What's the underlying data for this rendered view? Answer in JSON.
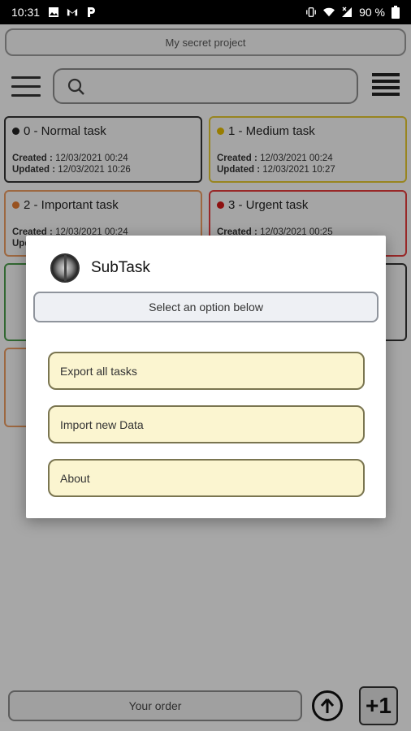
{
  "status_bar": {
    "time": "10:31",
    "battery": "90 %",
    "left_icons": [
      "image-icon",
      "gmail-icon",
      "p-app-icon"
    ],
    "right_icons": [
      "vibrate-icon",
      "wifi-icon",
      "signal-icon",
      "battery-icon"
    ]
  },
  "header": {
    "project_title": "My secret project",
    "search_placeholder": ""
  },
  "tasks": [
    {
      "title": "0 - Normal task",
      "created_label": "Created :",
      "created": "12/03/2021 00:24",
      "updated_label": "Updated :",
      "updated": "12/03/2021 10:26",
      "color": "#222222",
      "border": "#333333"
    },
    {
      "title": "1 - Medium task",
      "created_label": "Created :",
      "created": "12/03/2021 00:24",
      "updated_label": "Updated :",
      "updated": "12/03/2021 10:27",
      "color": "#e0b800",
      "border": "#e0c530"
    },
    {
      "title": "2 - Important task",
      "created_label": "Created :",
      "created": "12/03/2021 00:24",
      "updated_label": "Upd",
      "updated": "",
      "color": "#e07a30",
      "border": "#e89a60"
    },
    {
      "title": "3 - Urgent task",
      "created_label": "Created :",
      "created": "12/03/2021 00:25",
      "updated_label": "",
      "updated": "",
      "color": "#d01818",
      "border": "#e03b3b"
    }
  ],
  "bottom": {
    "order_label": "Your order",
    "add_label": "+1"
  },
  "dialog": {
    "title": "SubTask",
    "subtitle": "Select an option below",
    "options": [
      "Export all tasks",
      "Import new Data",
      "About"
    ]
  },
  "colors": {
    "option_bg": "#fbf5d0",
    "option_border": "#7a7550",
    "subtitle_bg": "#eef0f4"
  }
}
